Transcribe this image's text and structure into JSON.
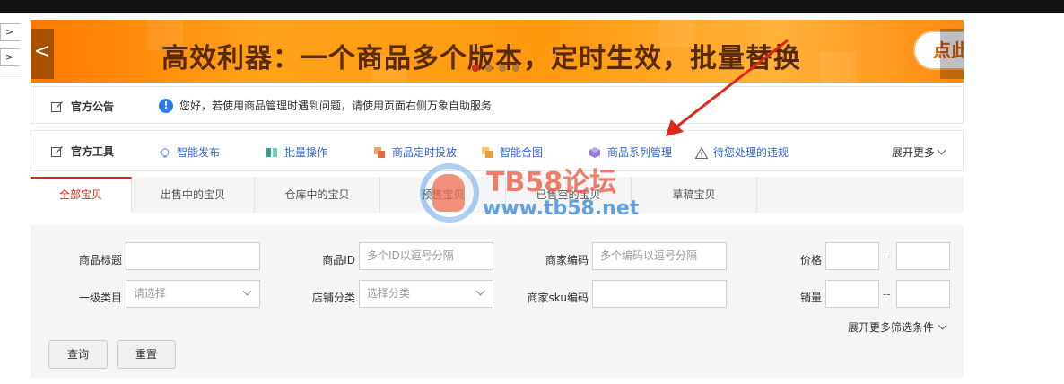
{
  "left_rail": {
    "items": [
      ">",
      ">"
    ]
  },
  "banner": {
    "headline": "高效利器：一个商品多个版本，定时生效，批量替换",
    "cta_label": "点此",
    "prev_label": "<"
  },
  "notice": {
    "label": "官方公告",
    "message": "您好，若使用商品管理时遇到问题，请使用页面右侧万象自助服务"
  },
  "tools": {
    "label": "官方工具",
    "items": [
      {
        "label": "智能发布",
        "icon": "bulb-icon"
      },
      {
        "label": "批量操作",
        "icon": "book-icon"
      },
      {
        "label": "商品定时投放",
        "icon": "copy-icon"
      },
      {
        "label": "智能合图",
        "icon": "copy-icon"
      },
      {
        "label": "商品系列管理",
        "icon": "cube-icon"
      },
      {
        "label": "待您处理的违规",
        "icon": "warning-icon"
      }
    ],
    "expand_label": "展开更多"
  },
  "tabs": [
    "全部宝贝",
    "出售中的宝贝",
    "仓库中的宝贝",
    "预售宝贝",
    "已售空的宝贝",
    "草稿宝贝"
  ],
  "filters": {
    "title_label": "商品标题",
    "id_label": "商品ID",
    "id_placeholder": "多个ID以逗号分隔",
    "code_label": "商家编码",
    "code_placeholder": "多个编码以逗号分隔",
    "price_label": "价格",
    "category_label": "一级类目",
    "category_value": "请选择",
    "shop_category_label": "店铺分类",
    "shop_category_value": "选择分类",
    "sku_code_label": "商家sku编码",
    "sales_label": "销量",
    "range_sep": "--",
    "more_label": "展开更多筛选条件",
    "search_button": "查询",
    "reset_button": "重置"
  },
  "watermark": {
    "title": "TB58论坛",
    "url": "www.tb58.net"
  },
  "colors": {
    "accent": "#d62a1e",
    "link": "#3463c7",
    "banner": "#ff9a0f"
  }
}
